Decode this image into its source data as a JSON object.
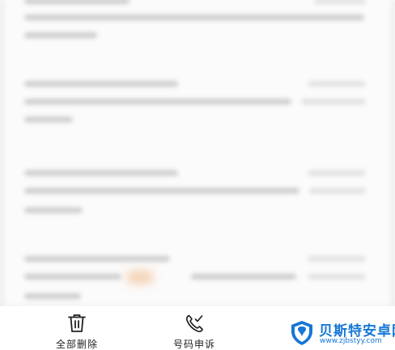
{
  "bottom_bar": {
    "delete_all": {
      "label": "全部删除",
      "icon": "trash-icon"
    },
    "number_appeal": {
      "label": "号码申诉",
      "icon": "phone-check-icon"
    }
  },
  "watermark": {
    "title": "贝斯特安卓网",
    "url": "www.zjbstyy.com"
  },
  "colors": {
    "background": "#fbfbfb",
    "bottom_bar": "#ffffff",
    "label_text": "#222222",
    "watermark_blue": "#1677d6"
  }
}
